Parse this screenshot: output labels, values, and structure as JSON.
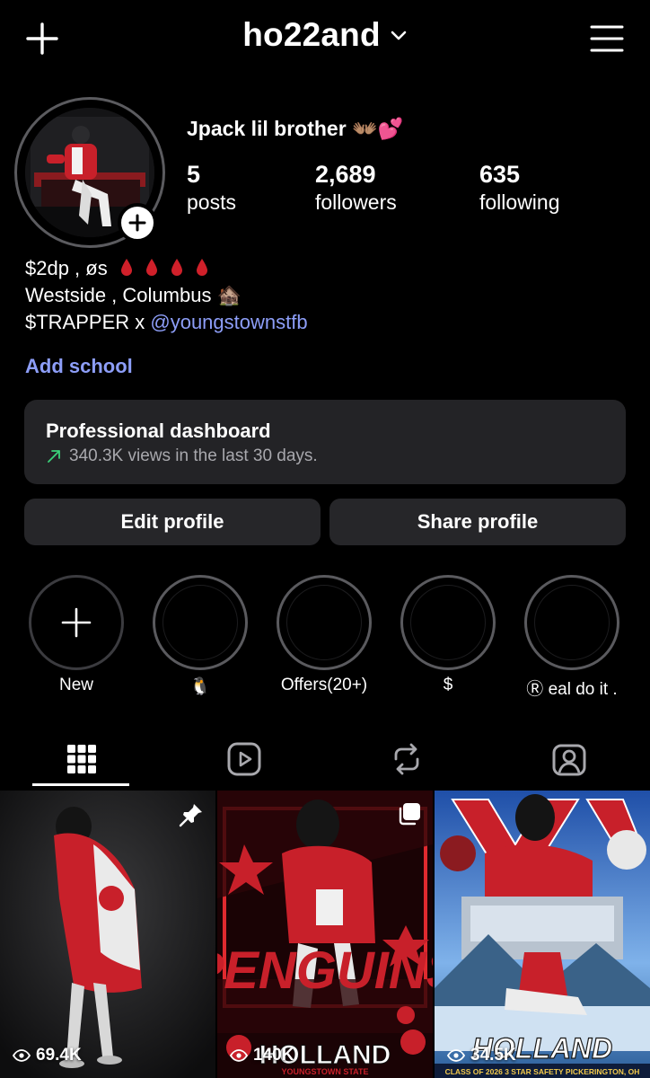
{
  "header": {
    "username": "ho22and",
    "icons": {
      "create": "plus-icon",
      "switch_account": "chevron-down-icon",
      "menu": "hamburger-menu-icon"
    }
  },
  "profile": {
    "display_name": "Jpack lil brother 👐🏽💕",
    "stats": [
      {
        "value": "5",
        "label": "posts"
      },
      {
        "value": "2,689",
        "label": "followers"
      },
      {
        "value": "635",
        "label": "following"
      }
    ],
    "bio": {
      "line1": "$2dp , øs",
      "line2": "Westside , Columbus 🏚️",
      "line3_prefix": "$TRAPPER x ",
      "line3_mention": "@youngstownstfb"
    },
    "add_school": "Add school"
  },
  "dashboard": {
    "title": "Professional dashboard",
    "subtitle": "340.3K views in the last 30 days."
  },
  "buttons": {
    "edit_profile": "Edit profile",
    "share_profile": "Share profile"
  },
  "highlights": [
    {
      "label": "New"
    },
    {
      "label": "🐧"
    },
    {
      "label": "Offers(20+)"
    },
    {
      "label": "$"
    },
    {
      "label": "Ⓡ eal do it ."
    }
  ],
  "tabs": [
    "grid-icon",
    "reels-icon",
    "reposts-icon",
    "tagged-icon"
  ],
  "posts": [
    {
      "views": "69.4K",
      "badge": "pin-icon"
    },
    {
      "views": "140K",
      "overlay_text": "HOLLAND",
      "caption": "YOUNGSTOWN STATE",
      "badge": "multi-post-icon"
    },
    {
      "views": "34.5K",
      "overlay_text": "HOLLAND",
      "caption": "CLASS OF 2026 3 STAR SAFETY PICKERINGTON, OH"
    }
  ],
  "colors": {
    "background": "#000000",
    "link": "#8d9ef8",
    "card": "#232326",
    "button": "#262629",
    "accent_red": "#d0202a",
    "trend_green": "#3bd27a"
  }
}
